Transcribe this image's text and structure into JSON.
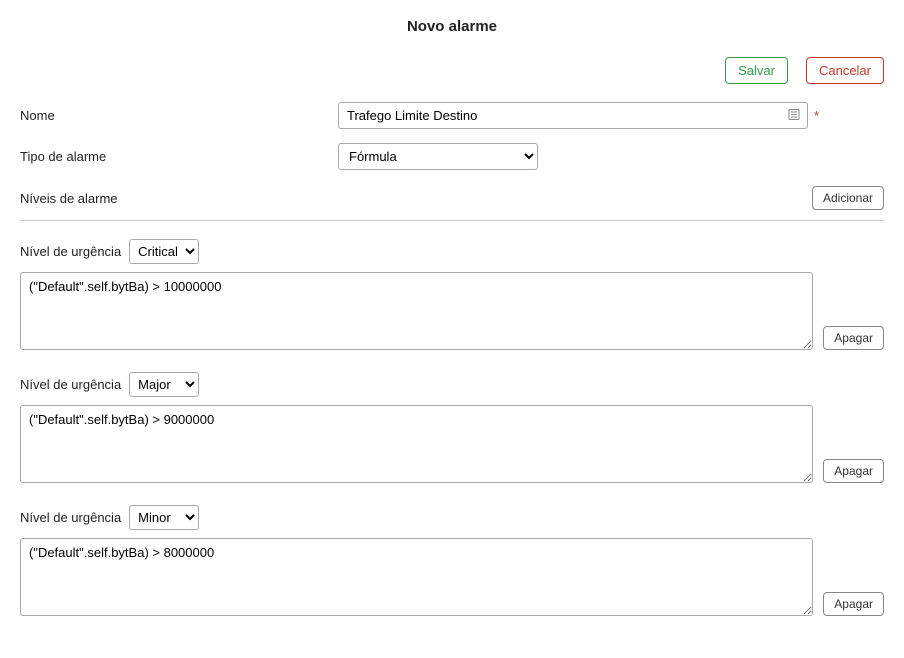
{
  "title": "Novo alarme",
  "buttons": {
    "save": "Salvar",
    "cancel": "Cancelar",
    "add": "Adicionar",
    "delete": "Apagar"
  },
  "form": {
    "name_label": "Nome",
    "name_value": "Trafego Limite Destino",
    "type_label": "Tipo de alarme",
    "type_value": "Fórmula",
    "levels_label": "Níveis de alarme",
    "urgency_label": "Nível de urgência"
  },
  "levels": [
    {
      "urgency": "Critical",
      "formula": "(\"Default\".self.bytBa) > 10000000"
    },
    {
      "urgency": "Major",
      "formula": "(\"Default\".self.bytBa) > 9000000"
    },
    {
      "urgency": "Minor",
      "formula": "(\"Default\".self.bytBa) > 8000000"
    }
  ]
}
